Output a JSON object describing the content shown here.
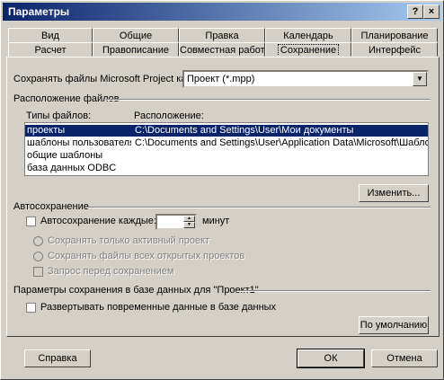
{
  "window": {
    "title": "Параметры"
  },
  "title_buttons": {
    "help": "?",
    "close": "×"
  },
  "tabs_row1": [
    "Вид",
    "Общие",
    "Правка",
    "Календарь",
    "Планирование"
  ],
  "tabs_row2": [
    "Расчет",
    "Правописание",
    "Совместная работа",
    "Сохранение",
    "Интерфейс"
  ],
  "save": {
    "label": "Сохранять файлы Microsoft Project как:",
    "value": "Проект (*.mpp)"
  },
  "file_locations": {
    "group_label": "Расположение файлов",
    "col_type": "Типы файлов:",
    "col_location": "Расположение:",
    "rows": [
      {
        "type": "проекты",
        "location": "C:\\Documents and Settings\\User\\Мои документы"
      },
      {
        "type": "шаблоны пользователя",
        "location": "C:\\Documents and Settings\\User\\Application Data\\Microsoft\\Шаблоны\\"
      },
      {
        "type": "общие шаблоны",
        "location": ""
      },
      {
        "type": "база данных ODBC",
        "location": ""
      }
    ],
    "change_button": "Изменить..."
  },
  "autosave": {
    "group_label": "Автосохранение",
    "checkbox_label": "Автосохранение каждые:",
    "interval_value": "",
    "minutes_label": "минут",
    "option_active": "Сохранять только активный проект",
    "option_all": "Сохранять файлы всех открытых проектов",
    "prompt_label": "Запрос перед сохранением"
  },
  "db_options": {
    "group_label": "Параметры сохранения в базе данных для \"Проект1\"",
    "expand_label": "Развертывать повременные данные в базе данных",
    "default_button": "По умолчанию"
  },
  "footer": {
    "help": "Справка",
    "ok": "ОК",
    "cancel": "Отмена"
  }
}
